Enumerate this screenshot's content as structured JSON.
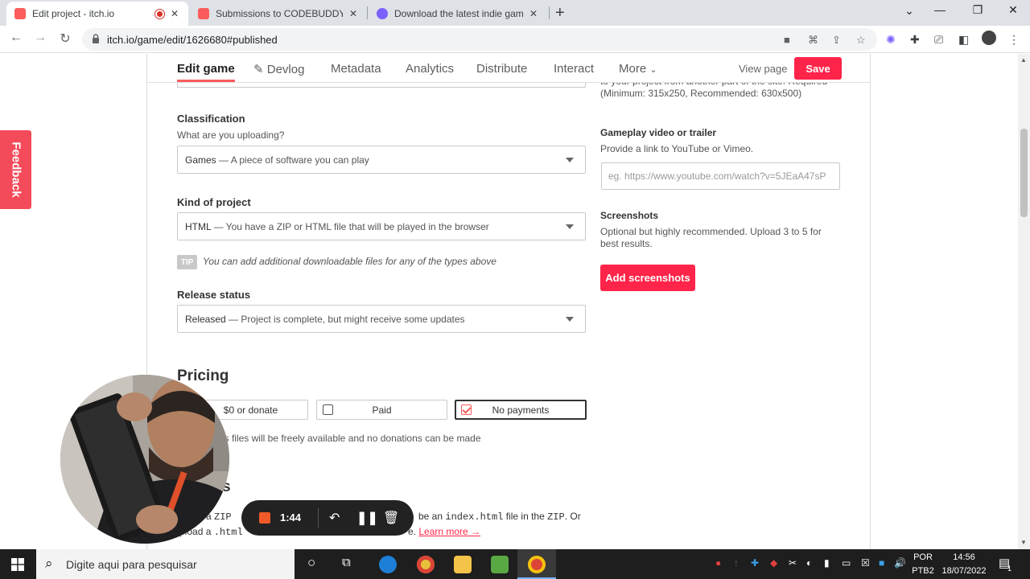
{
  "browser": {
    "tabs": [
      {
        "title": "Edit project - itch.io",
        "favicon_color": "#fa5c5c"
      },
      {
        "title": "Submissions to CODEBUDDY // P",
        "favicon_color": "#fa5c5c"
      },
      {
        "title": "Download the latest indie games",
        "favicon_color": "#7b61ff"
      }
    ],
    "url": "itch.io/game/edit/1626680#published"
  },
  "subnav": {
    "items": [
      "Edit game",
      "Devlog",
      "Metadata",
      "Analytics",
      "Distribute",
      "Interact",
      "More"
    ],
    "view_page": "View page",
    "save": "Save"
  },
  "form": {
    "classification": {
      "label": "Classification",
      "sub": "What are you uploading?",
      "value_strong": "Games",
      "value_rest": " — A piece of software you can play"
    },
    "kind": {
      "label": "Kind of project",
      "value_strong": "HTML",
      "value_rest": " — You have a ZIP or HTML file that will be played in the browser"
    },
    "tip": {
      "badge": "TIP",
      "text": "You can add additional downloadable files for any of the types above"
    },
    "release": {
      "label": "Release status",
      "value_strong": "Released",
      "value_rest": " — Project is complete, but might receive some updates"
    },
    "pricing": {
      "heading": "Pricing",
      "options": [
        "$0 or donate",
        "Paid",
        "No payments"
      ],
      "selected": "No payments",
      "desc": "t's files will be freely available and no donations can be made"
    },
    "uploads": {
      "heading_tail": "s",
      "line1_a": "d a ",
      "line1_code1": "ZIP",
      "line1_b": "be an ",
      "line1_code2": "index.html",
      "line1_c": " file in the ",
      "line1_code3": "ZIP",
      "line1_d": ". Or",
      "line2_a": "pload a ",
      "line2_code": ".html",
      "line2_b": "e. ",
      "learn_more": "Learn more →"
    }
  },
  "sidebar": {
    "cover_text": "to your project from another part of the site. Required (Minimum: 315x250, Recommended: 630x500)",
    "video": {
      "label": "Gameplay video or trailer",
      "sub": "Provide a link to YouTube or Vimeo.",
      "placeholder": "eg. https://www.youtube.com/watch?v=5JEaA47sP"
    },
    "screenshots": {
      "label": "Screenshots",
      "sub": "Optional but highly recommended. Upload 3 to 5 for best results.",
      "button": "Add screenshots"
    }
  },
  "feedback": "Feedback",
  "recorder": {
    "time": "1:44"
  },
  "taskbar": {
    "search_placeholder": "Digite aqui para pesquisar",
    "lang_top": "POR",
    "lang_bottom": "PTB2",
    "time": "14:56",
    "date": "18/07/2022",
    "notification_count": "1"
  }
}
